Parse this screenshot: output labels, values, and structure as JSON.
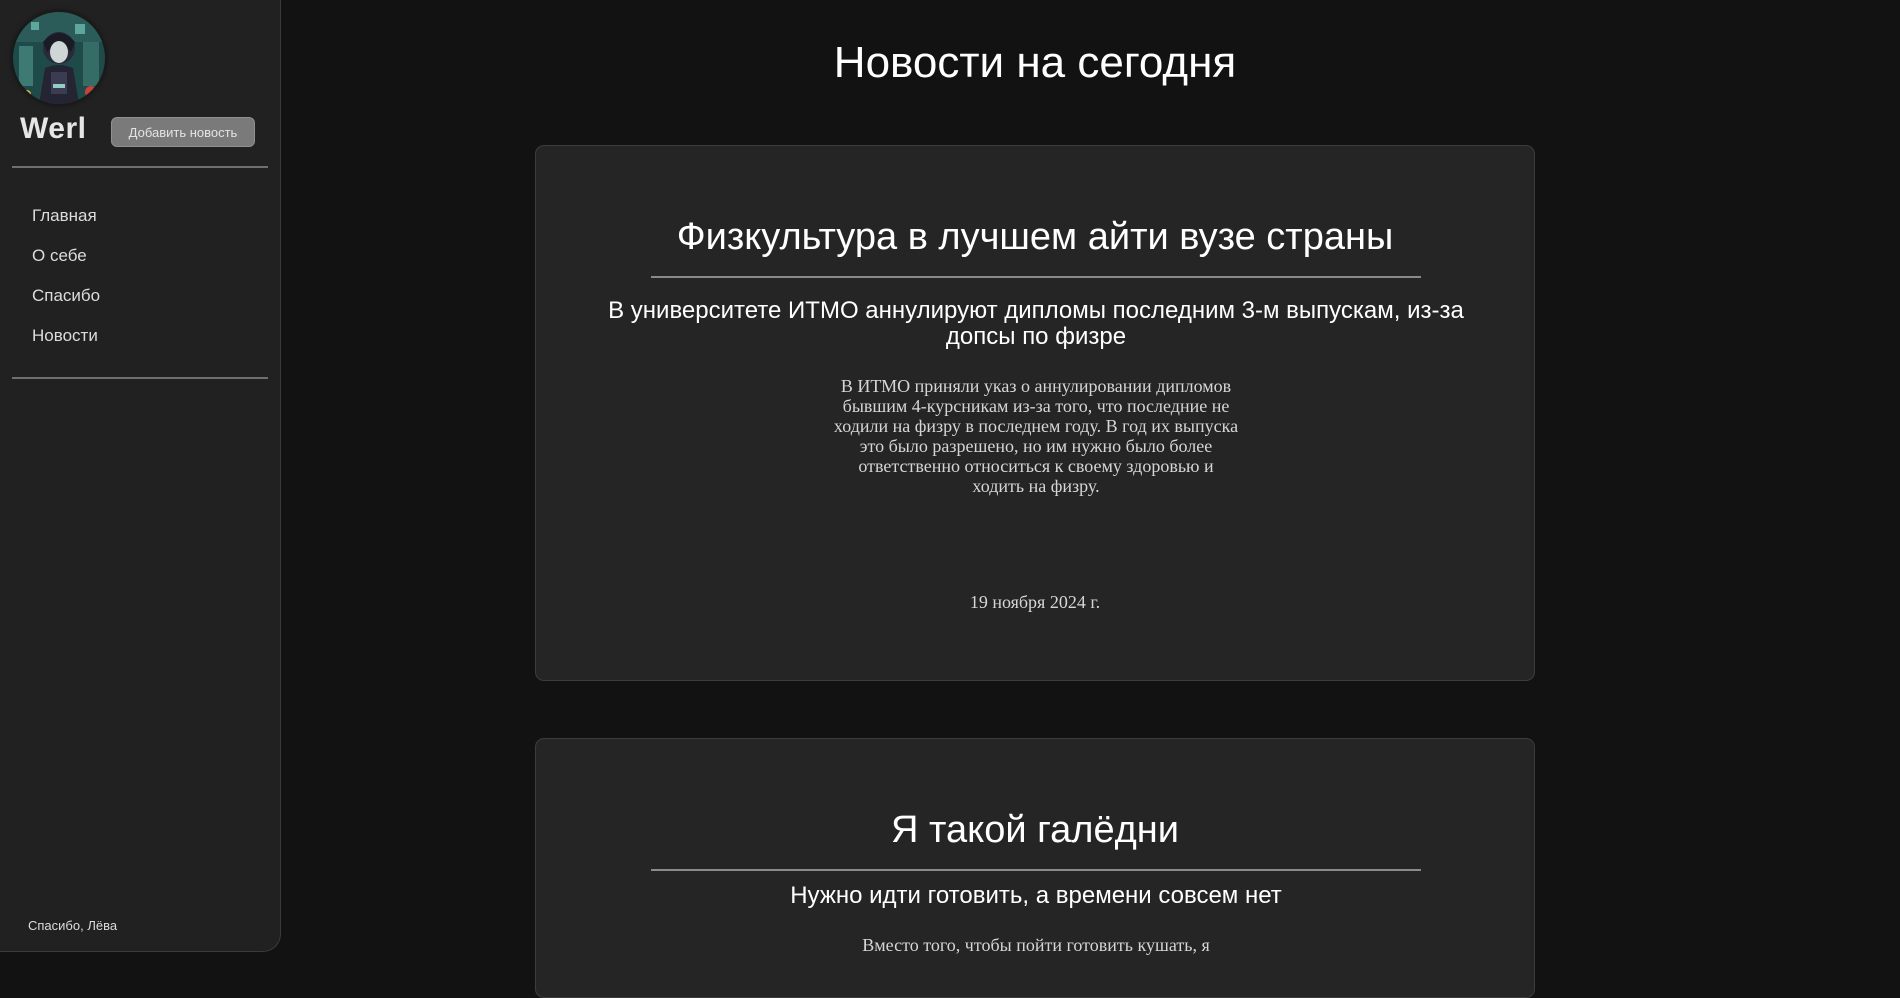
{
  "sidebar": {
    "avatar_icon": "anime-avatar-icon",
    "username": "Werl",
    "add_news_label": "Добавить новость",
    "nav_items": [
      {
        "label": "Главная"
      },
      {
        "label": "О себе"
      },
      {
        "label": "Спасибо"
      },
      {
        "label": "Новости"
      }
    ],
    "footer_text": "Спасибо, Лёва"
  },
  "main": {
    "title": "Новости на сегодня",
    "news": [
      {
        "title": "Физкультура в лучшем айти вузе страны",
        "subtitle": "В университете ИТМО аннулируют дипломы последним 3-м выпускам, из-за допсы по физре",
        "body": "В ИТМО приняли указ о аннулировании дипломов бывшим 4-курсникам из-за того, что последние не ходили на физру в последнем году. В год их выпуска это было разрешено, но им нужно было более ответственно относиться к своему здоровью и ходить на физру.",
        "date": "19 ноября 2024 г."
      },
      {
        "title": "Я такой галёдни",
        "subtitle": "Нужно идти готовить, а времени совсем нет",
        "body": "Вместо того, чтобы пойти готовить кушать, я"
      }
    ]
  },
  "colors": {
    "background": "#121212",
    "sidebar": "#212121",
    "card": "#252525",
    "button": "#7a7a7a"
  }
}
